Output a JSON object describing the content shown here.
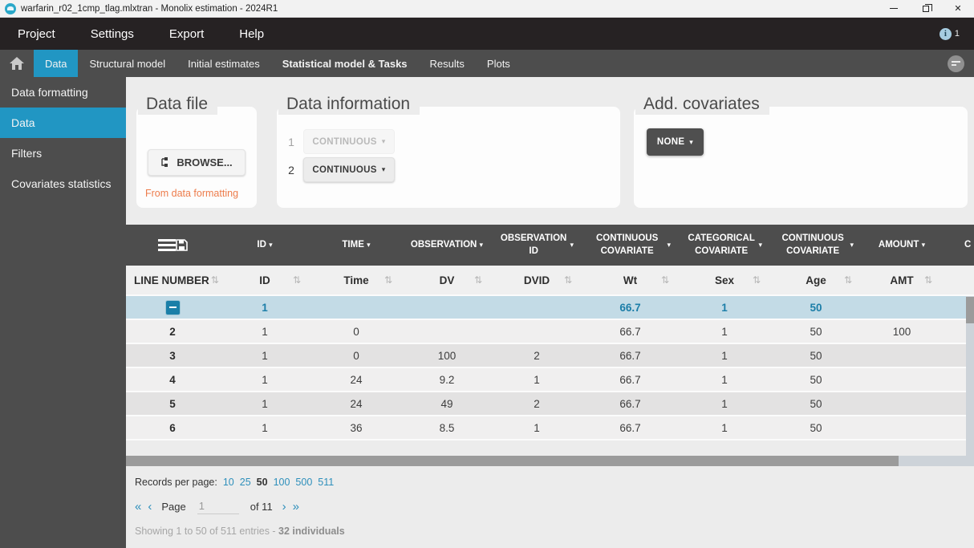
{
  "window": {
    "title": "warfarin_r02_1cmp_tlag.mlxtran - Monolix estimation - 2024R1",
    "close_glyph": "✕"
  },
  "menubar": {
    "items": [
      "Project",
      "Settings",
      "Export",
      "Help"
    ],
    "info_glyph": "i",
    "notification_count": "1"
  },
  "tabbar": {
    "tabs": [
      {
        "label": "Data"
      },
      {
        "label": "Structural model"
      },
      {
        "label": "Initial estimates"
      },
      {
        "label": "Statistical model & Tasks"
      },
      {
        "label": "Results"
      },
      {
        "label": "Plots"
      }
    ]
  },
  "sidebar": {
    "items": [
      {
        "label": "Data formatting"
      },
      {
        "label": "Data"
      },
      {
        "label": "Filters"
      },
      {
        "label": "Covariates statistics"
      }
    ]
  },
  "panels": {
    "data_file": {
      "title": "Data file",
      "browse_label": "BROWSE...",
      "link": "From data formatting"
    },
    "data_information": {
      "title": "Data information",
      "row1_index": "1",
      "row1_value": "CONTINUOUS",
      "row2_index": "2",
      "row2_value": "CONTINUOUS"
    },
    "add_covariates": {
      "title": "Add. covariates",
      "dropdown_value": "NONE"
    }
  },
  "table": {
    "group_headers": [
      "ID",
      "TIME",
      "OBSERVATION",
      "OBSERVATION ID",
      "CONTINUOUS COVARIATE",
      "CATEGORICAL COVARIATE",
      "CONTINUOUS COVARIATE",
      "AMOUNT",
      "C"
    ],
    "columns": [
      "LINE NUMBER",
      "ID",
      "Time",
      "DV",
      "DVID",
      "Wt",
      "Sex",
      "Age",
      "AMT"
    ],
    "rows": [
      {
        "line": "",
        "id": "1",
        "time": "",
        "dv": "",
        "dvid": "",
        "wt": "66.7",
        "sex": "1",
        "age": "50",
        "amt": ""
      },
      {
        "line": "2",
        "id": "1",
        "time": "0",
        "dv": "",
        "dvid": "",
        "wt": "66.7",
        "sex": "1",
        "age": "50",
        "amt": "100"
      },
      {
        "line": "3",
        "id": "1",
        "time": "0",
        "dv": "100",
        "dvid": "2",
        "wt": "66.7",
        "sex": "1",
        "age": "50",
        "amt": ""
      },
      {
        "line": "4",
        "id": "1",
        "time": "24",
        "dv": "9.2",
        "dvid": "1",
        "wt": "66.7",
        "sex": "1",
        "age": "50",
        "amt": ""
      },
      {
        "line": "5",
        "id": "1",
        "time": "24",
        "dv": "49",
        "dvid": "2",
        "wt": "66.7",
        "sex": "1",
        "age": "50",
        "amt": ""
      },
      {
        "line": "6",
        "id": "1",
        "time": "36",
        "dv": "8.5",
        "dvid": "1",
        "wt": "66.7",
        "sex": "1",
        "age": "50",
        "amt": ""
      }
    ]
  },
  "footer": {
    "records_label": "Records per page:",
    "page_sizes": [
      "10",
      "25",
      "50",
      "100",
      "500",
      "511"
    ],
    "selected_page_size": "50",
    "pagination": {
      "first": "«",
      "prev": "‹",
      "page_label": "Page",
      "page_value": "1",
      "of_label": "of 11",
      "next": "›",
      "last": "»"
    },
    "summary": "Showing 1 to 50 of 511 entries - ",
    "summary_bold": "32 individuals"
  },
  "icons": {
    "sort": "⇅",
    "caret": "▾"
  },
  "colors": {
    "accent_blue": "#2196c3",
    "selected_row_bg": "#c3dbe6",
    "selected_row_text": "#1c7ea8",
    "orange_link": "#ed7c4b",
    "dark_gray": "#4d4d4d",
    "menubar": "#262223"
  }
}
